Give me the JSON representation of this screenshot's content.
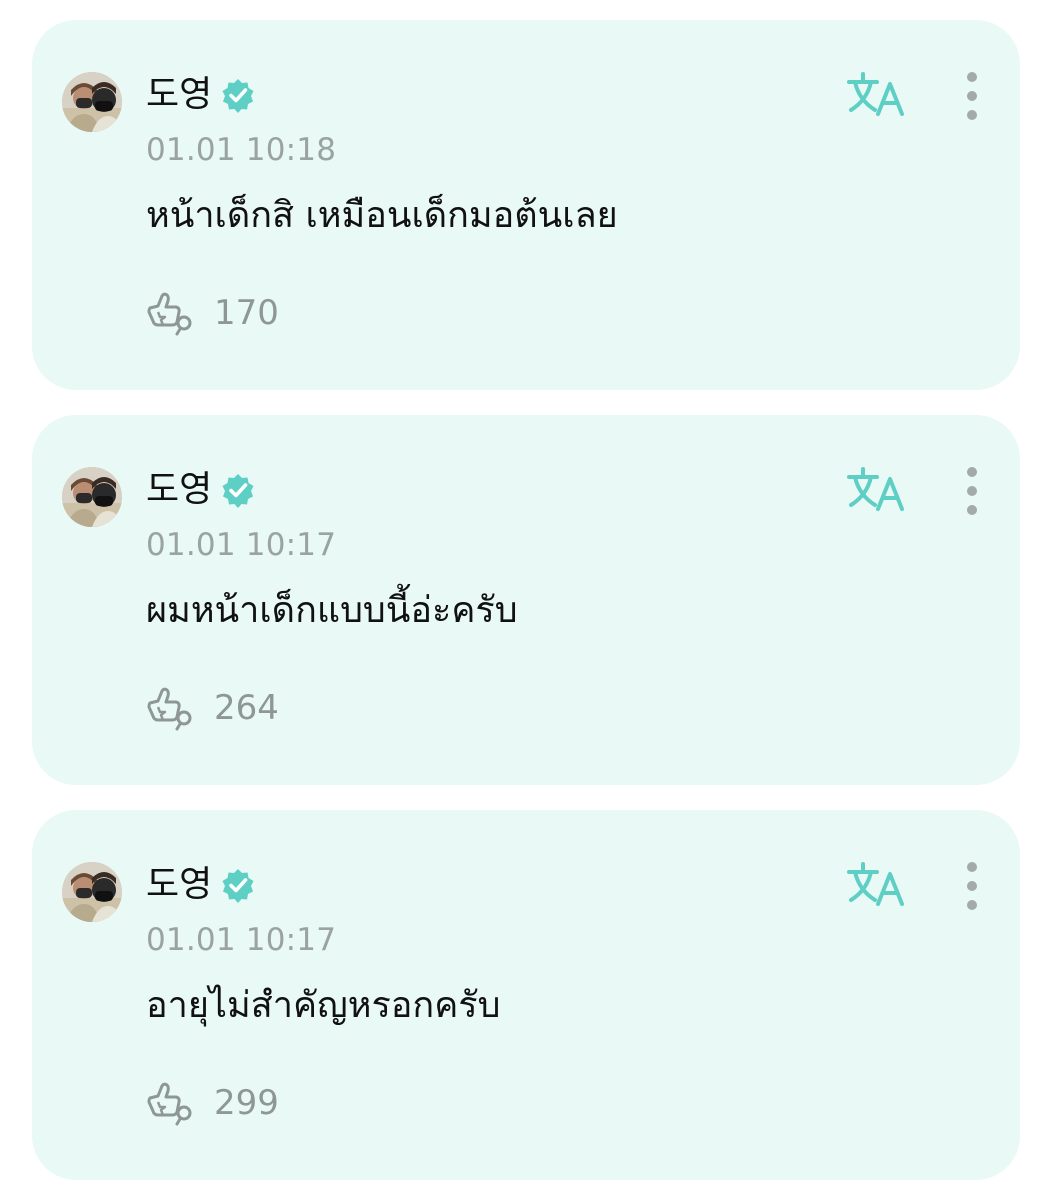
{
  "colors": {
    "card_background": "#e8f9f6",
    "accent": "#5ecfc4",
    "text": "#111111",
    "muted": "#9aa3a1"
  },
  "comments": [
    {
      "author": "도영",
      "verified": true,
      "timestamp": "01.01 10:18",
      "text": "หน้าเด็กสิ เหมือนเด็กมอต้นเลย",
      "likes": "170"
    },
    {
      "author": "도영",
      "verified": true,
      "timestamp": "01.01 10:17",
      "text": "ผมหน้าเด็กแบบนี้อ่ะครับ",
      "likes": "264"
    },
    {
      "author": "도영",
      "verified": true,
      "timestamp": "01.01 10:17",
      "text": "อายุไม่สำคัญหรอกครับ",
      "likes": "299"
    }
  ],
  "icons": {
    "translate": "translate-icon",
    "more": "more-vertical-icon",
    "like": "like-hand-icon",
    "verified": "verified-badge-icon"
  }
}
